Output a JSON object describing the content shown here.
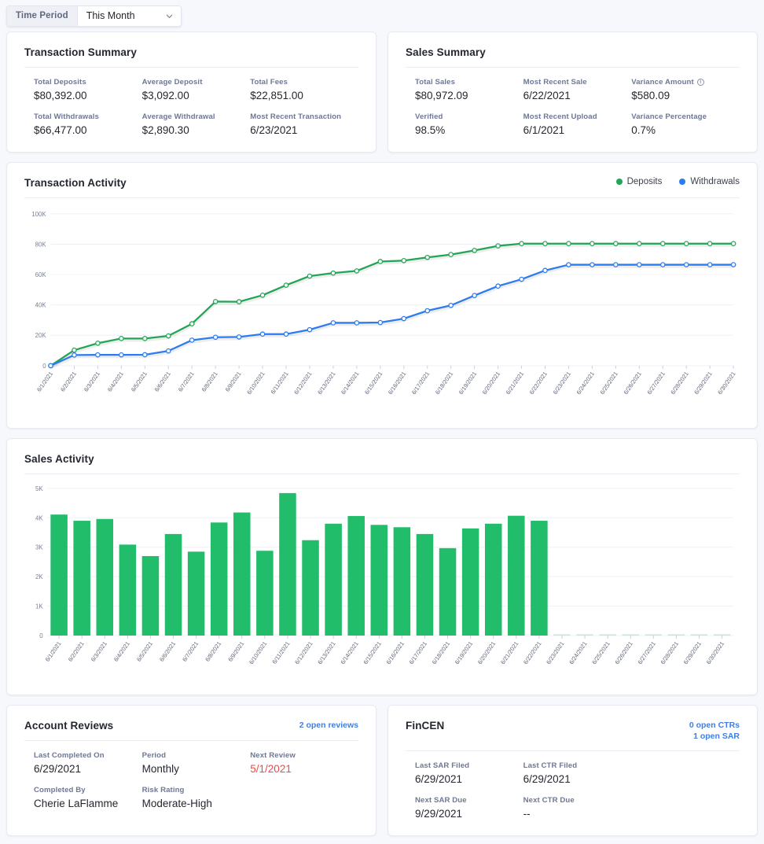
{
  "toolbar": {
    "time_period_label": "Time Period",
    "time_period_value": "This Month",
    "chevron_icon": "chevron-down-icon"
  },
  "transaction_summary": {
    "title": "Transaction Summary",
    "fields": [
      {
        "label": "Total Deposits",
        "value": "$80,392.00"
      },
      {
        "label": "Average Deposit",
        "value": "$3,092.00"
      },
      {
        "label": "Total Fees",
        "value": "$22,851.00"
      },
      {
        "label": "Total Withdrawals",
        "value": "$66,477.00"
      },
      {
        "label": "Average Withdrawal",
        "value": "$2,890.30"
      },
      {
        "label": "Most Recent Transaction",
        "value": "6/23/2021"
      }
    ]
  },
  "sales_summary": {
    "title": "Sales Summary",
    "fields": [
      {
        "label": "Total Sales",
        "value": "$80,972.09"
      },
      {
        "label": "Most Recent Sale",
        "value": "6/22/2021"
      },
      {
        "label": "Variance Amount",
        "value": "$580.09",
        "info_icon": "info-circle-icon"
      },
      {
        "label": "Verified",
        "value": "98.5%"
      },
      {
        "label": "Most Recent Upload",
        "value": "6/1/2021"
      },
      {
        "label": "Variance Percentage",
        "value": "0.7%"
      }
    ]
  },
  "transaction_activity": {
    "title": "Transaction Activity",
    "legend": [
      {
        "label": "Deposits",
        "color": "#22a556"
      },
      {
        "label": "Withdrawals",
        "color": "#2b7cf0"
      }
    ]
  },
  "sales_activity": {
    "title": "Sales Activity"
  },
  "account_reviews": {
    "title": "Account Reviews",
    "link": "2 open reviews",
    "fields": [
      {
        "label": "Last Completed On",
        "value": "6/29/2021"
      },
      {
        "label": "Period",
        "value": "Monthly"
      },
      {
        "label": "Next Review",
        "value": "5/1/2021",
        "alert": true
      },
      {
        "label": "Completed By",
        "value": "Cherie LaFlamme"
      },
      {
        "label": "Risk Rating",
        "value": "Moderate-High"
      }
    ]
  },
  "fincen": {
    "title": "FinCEN",
    "link_line1": "0 open CTRs",
    "link_line2": "1 open SAR",
    "fields": [
      {
        "label": "Last SAR Filed",
        "value": "6/29/2021"
      },
      {
        "label": "Last CTR Filed",
        "value": "6/29/2021"
      },
      {
        "label": "Next SAR Due",
        "value": "9/29/2021"
      },
      {
        "label": "Next CTR Due",
        "value": "--"
      }
    ]
  },
  "colors": {
    "deposits": "#22a556",
    "withdrawals": "#2b7cf0",
    "bars": "#22bd6a",
    "alert": "#f0474a",
    "link": "#3f7fe0"
  },
  "chart_data": [
    {
      "type": "line",
      "title": "Transaction Activity",
      "xlabel": "",
      "ylabel": "",
      "ylim": [
        0,
        100000
      ],
      "yticks": [
        0,
        20000,
        40000,
        60000,
        80000,
        100000
      ],
      "ytick_labels": [
        "0",
        "20K",
        "40K",
        "60K",
        "80K",
        "100K"
      ],
      "grid": true,
      "legend_position": "top-right",
      "x": [
        "6/1/2021",
        "6/2/2021",
        "6/3/2021",
        "6/4/2021",
        "6/5/2021",
        "6/6/2021",
        "6/7/2021",
        "6/8/2021",
        "6/9/2021",
        "6/10/2021",
        "6/11/2021",
        "6/12/2021",
        "6/13/2021",
        "6/14/2021",
        "6/15/2021",
        "6/16/2021",
        "6/17/2021",
        "6/18/2021",
        "6/19/2021",
        "6/20/2021",
        "6/21/2021",
        "6/22/2021",
        "6/23/2021",
        "6/24/2021",
        "6/25/2021",
        "6/26/2021",
        "6/27/2021",
        "6/28/2021",
        "6/29/2021",
        "6/30/2021"
      ],
      "series": [
        {
          "name": "Deposits",
          "color": "#22a556",
          "values": [
            0,
            10200,
            14800,
            17900,
            17900,
            19600,
            27600,
            42200,
            42100,
            46400,
            53000,
            59000,
            61000,
            62400,
            68600,
            69200,
            71300,
            73200,
            75900,
            78900,
            80392,
            80392,
            80392,
            80392,
            80392,
            80392,
            80392,
            80392,
            80392,
            80392
          ]
        },
        {
          "name": "Withdrawals",
          "color": "#2b7cf0",
          "values": [
            0,
            7000,
            7100,
            7100,
            7200,
            9700,
            16800,
            18700,
            18900,
            20800,
            20800,
            23700,
            28200,
            28200,
            28400,
            31000,
            36200,
            39700,
            46200,
            52400,
            56900,
            62700,
            66477,
            66477,
            66477,
            66477,
            66477,
            66477,
            66477,
            66477
          ]
        }
      ]
    },
    {
      "type": "bar",
      "title": "Sales Activity",
      "xlabel": "",
      "ylabel": "",
      "ylim": [
        0,
        5000
      ],
      "yticks": [
        0,
        1000,
        2000,
        3000,
        4000,
        5000
      ],
      "ytick_labels": [
        "0",
        "1K",
        "2K",
        "3K",
        "4K",
        "5K"
      ],
      "grid": true,
      "color": "#22bd6a",
      "categories": [
        "6/1/2021",
        "6/2/2021",
        "6/3/2021",
        "6/4/2021",
        "6/5/2021",
        "6/6/2021",
        "6/7/2021",
        "6/8/2021",
        "6/9/2021",
        "6/10/2021",
        "6/11/2021",
        "6/12/2021",
        "6/13/2021",
        "6/14/2021",
        "6/15/2021",
        "6/16/2021",
        "6/17/2021",
        "6/18/2021",
        "6/19/2021",
        "6/20/2021",
        "6/21/2021",
        "6/22/2021",
        "6/23/2021",
        "6/24/2021",
        "6/25/2021",
        "6/26/2021",
        "6/27/2021",
        "6/28/2021",
        "6/29/2021",
        "6/30/2021"
      ],
      "values": [
        4110,
        3900,
        3960,
        3090,
        2700,
        3450,
        2850,
        3840,
        4180,
        2880,
        4840,
        3240,
        3800,
        4060,
        3760,
        3680,
        3450,
        2970,
        3640,
        3800,
        4070,
        3900,
        0,
        0,
        0,
        0,
        0,
        0,
        0,
        0
      ]
    }
  ]
}
